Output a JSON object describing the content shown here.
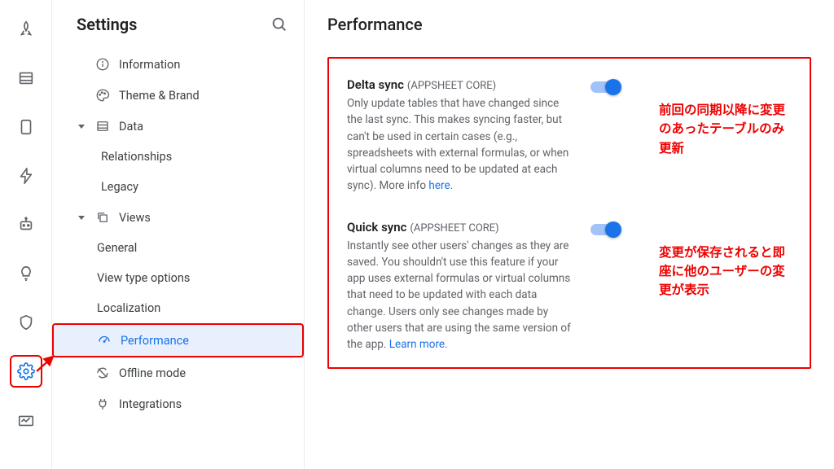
{
  "settings": {
    "panelTitle": "Settings",
    "nav": {
      "information": "Information",
      "theme": "Theme & Brand",
      "data": "Data",
      "relationships": "Relationships",
      "legacy": "Legacy",
      "views": "Views",
      "general": "General",
      "viewTypeOptions": "View type options",
      "localization": "Localization",
      "performance": "Performance",
      "offline": "Offline mode",
      "integrations": "Integrations"
    }
  },
  "main": {
    "pageTitle": "Performance",
    "deltaSync": {
      "title": "Delta sync",
      "badge": "(APPSHEET CORE)",
      "desc": "Only update tables that have changed since the last sync. This makes syncing faster, but can't be used in certain cases (e.g., spreadsheets with external formulas, or when virtual columns need to be updated at each sync). More info ",
      "link": "here",
      "dot": ".",
      "annot": "前回の同期以降に変更のあったテーブルのみ更新"
    },
    "quickSync": {
      "title": "Quick sync",
      "badge": "(APPSHEET CORE)",
      "desc": "Instantly see other users' changes as they are saved. You shouldn't use this feature if your app uses external formulas or virtual columns that need to be updated with each data change. Users only see changes made by other users that are using the same version of the app. ",
      "link": "Learn more",
      "dot": ".",
      "annot": "変更が保存されると即座に他のユーザーの変更が表示"
    }
  }
}
